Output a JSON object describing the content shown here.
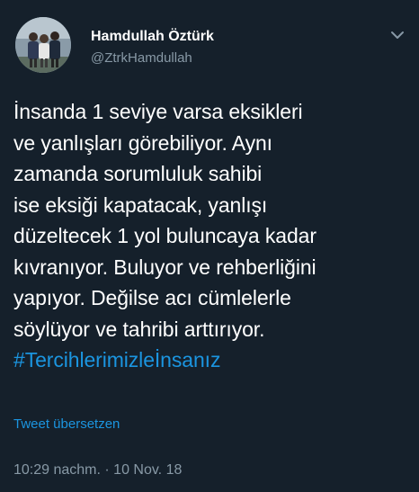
{
  "author": {
    "display_name": "Hamdullah Öztürk",
    "handle": "@ZtrkHamdullah",
    "avatar_icon": "profile-photo"
  },
  "menu_icon": "chevron-down-icon",
  "tweet": {
    "lines": [
      "İnsanda 1 seviye varsa eksikleri",
      "ve yanlışları görebiliyor. Aynı",
      "zamanda sorumluluk sahibi",
      "ise eksiği kapatacak, yanlışı",
      "düzeltecek 1 yol buluncaya kadar",
      "kıvranıyor. Buluyor ve rehberliğini",
      "yapıyor. Değilse acı cümlelerle",
      "söylüyor ve tahribi arttırıyor."
    ],
    "hashtag": "#Tercihlerimizleİnsanız"
  },
  "translate_label": "Tweet übersetzen",
  "timestamp": "10:29 nachm. · 10 Nov. 18",
  "colors": {
    "background": "#15202b",
    "text": "#ffffff",
    "secondary": "#8899a6",
    "link": "#1b95e0"
  }
}
